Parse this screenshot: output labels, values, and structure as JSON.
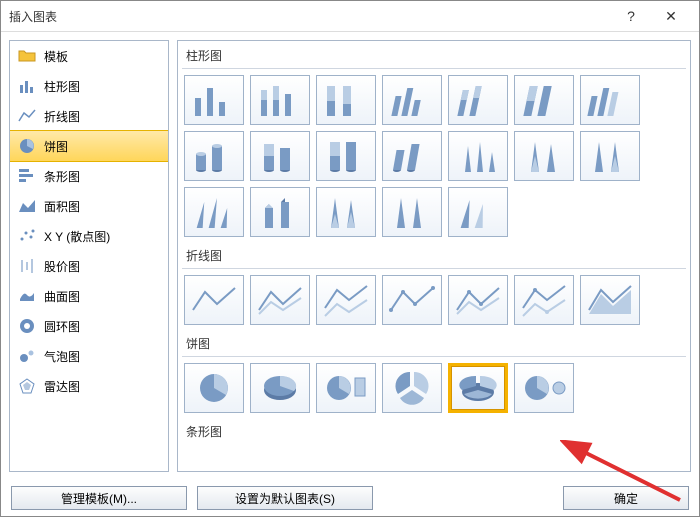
{
  "dialog": {
    "title": "插入图表",
    "help_symbol": "?",
    "close_symbol": "✕"
  },
  "sidebar": {
    "items": [
      {
        "label": "模板"
      },
      {
        "label": "柱形图"
      },
      {
        "label": "折线图"
      },
      {
        "label": "饼图",
        "selected": true
      },
      {
        "label": "条形图"
      },
      {
        "label": "面积图"
      },
      {
        "label": "X Y (散点图)"
      },
      {
        "label": "股价图"
      },
      {
        "label": "曲面图"
      },
      {
        "label": "圆环图"
      },
      {
        "label": "气泡图"
      },
      {
        "label": "雷达图"
      }
    ]
  },
  "preview": {
    "groups": [
      {
        "label": "柱形图",
        "count": 19
      },
      {
        "label": "折线图",
        "count": 7
      },
      {
        "label": "饼图",
        "count": 6,
        "selected_index": 4
      },
      {
        "label": "条形图",
        "count": 0,
        "partial": true
      }
    ]
  },
  "footer": {
    "manage_templates": "管理模板(M)...",
    "set_default": "设置为默认图表(S)",
    "ok": "确定"
  }
}
